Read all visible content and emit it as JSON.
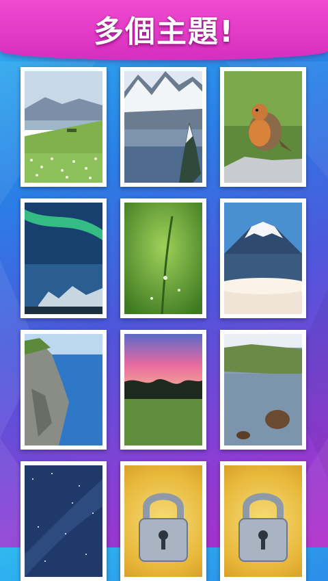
{
  "header": {
    "title": "多個主題!"
  },
  "colors": {
    "header": "#e43cc8",
    "lock": "#a9b4c2"
  },
  "themes": [
    {
      "name": "meadow-lake",
      "locked": false
    },
    {
      "name": "snowy-mountain-lake",
      "locked": false
    },
    {
      "name": "robin-bird",
      "locked": false
    },
    {
      "name": "aurora-night",
      "locked": false
    },
    {
      "name": "green-grass-dew",
      "locked": false
    },
    {
      "name": "mount-fuji",
      "locked": false
    },
    {
      "name": "sea-cliff",
      "locked": false
    },
    {
      "name": "sunset-field",
      "locked": false
    },
    {
      "name": "pond-rock",
      "locked": false
    },
    {
      "name": "starry-sky",
      "locked": false
    },
    {
      "name": "locked-theme-1",
      "locked": true,
      "icon": "padlock-icon"
    },
    {
      "name": "locked-theme-2",
      "locked": true,
      "icon": "padlock-icon"
    }
  ]
}
